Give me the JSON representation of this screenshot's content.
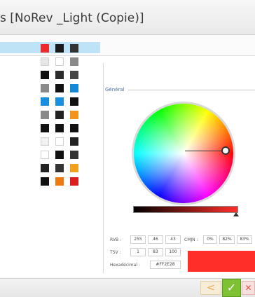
{
  "window": {
    "title": "s [NoRev _Light (Copie)]"
  },
  "section": {
    "label": "Général"
  },
  "palette": {
    "rows": [
      {
        "selected": true,
        "colors": [
          "#ed2a2a",
          "#1a1a1a",
          "#333333"
        ]
      },
      {
        "selected": false,
        "colors": [
          "#e6e6e6",
          "#ffffff",
          "#8a8a8a"
        ]
      },
      {
        "selected": false,
        "colors": [
          "#111111",
          "#2b2b2b",
          "#444444"
        ]
      },
      {
        "selected": false,
        "colors": [
          "#8a8a8a",
          "#111111",
          "#1588d6"
        ]
      },
      {
        "selected": false,
        "colors": [
          "#1a8fe0",
          "#1a8fe0",
          "#111111"
        ]
      },
      {
        "selected": false,
        "colors": [
          "#888888",
          "#222222",
          "#f2921f"
        ]
      },
      {
        "selected": false,
        "colors": [
          "#111111",
          "#111111",
          "#111111"
        ]
      },
      {
        "selected": false,
        "colors": [
          "#f2f2f2",
          "#ffffff",
          "#222222"
        ]
      },
      {
        "selected": false,
        "colors": [
          "#ffffff",
          "#111111",
          "#333333"
        ]
      },
      {
        "selected": false,
        "colors": [
          "#222222",
          "#333333",
          "#f2a11e"
        ]
      },
      {
        "selected": false,
        "colors": [
          "#111111",
          "#ee7a12",
          "#dd1e1e"
        ]
      }
    ]
  },
  "color": {
    "rvb_label": "RVB :",
    "r": "255",
    "g": "46",
    "b": "43",
    "cmjn_label": "CMJN :",
    "c": "0%",
    "m": "82%",
    "y": "83%",
    "tsv_label": "TSV :",
    "t": "1",
    "s": "83",
    "v": "100",
    "hex_label": "Hexadécimal :",
    "hex": "#FF2E28",
    "preview_color": "#ff2e28"
  },
  "footer": {
    "prev_symbol": "<",
    "ok_symbol": "✓",
    "cancel_symbol": "✕"
  }
}
